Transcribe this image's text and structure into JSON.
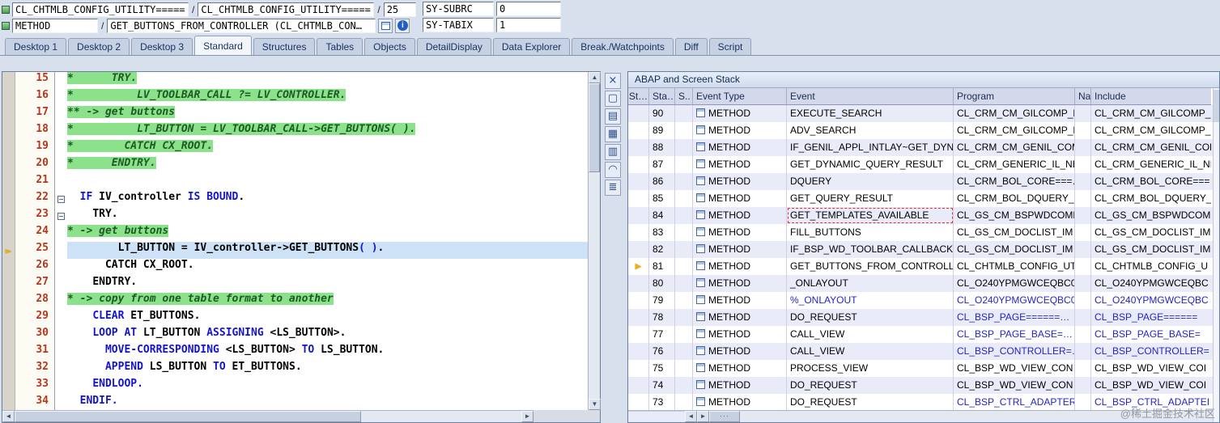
{
  "watermark": "@稀土掘金技术社区",
  "colors": {
    "comment_bg": "#8be28b",
    "comment_text": "#1d5a24",
    "current_line_bg": "#cde2f6",
    "keyword": "#1414cf",
    "line_number": "#b5381e",
    "stack_blue": "#2424c8",
    "arrow_yellow": "#f0b400",
    "selection_red": "#e03030"
  },
  "icons": {
    "up": "▲",
    "down": "▼",
    "left": "◄",
    "right": "►",
    "stack_arrow": "►",
    "info": "i"
  },
  "header": {
    "row1": {
      "program1": "CL_CHTMLB_CONFIG_UTILITY=====…",
      "sep1": "/",
      "program2": "CL_CHTMLB_CONFIG_UTILITY=====…",
      "sep2": "/",
      "line": "25",
      "sy_subrc_label": "SY-SUBRC",
      "sy_subrc_value": "0"
    },
    "row2": {
      "event_type": "METHOD",
      "sep": "/",
      "event": "GET_BUTTONS_FROM_CONTROLLER (CL_CHTMLB_CON…",
      "sy_tabix_label": "SY-TABIX",
      "sy_tabix_value": "1"
    }
  },
  "tabs": [
    {
      "label": "Desktop 1"
    },
    {
      "label": "Desktop 2"
    },
    {
      "label": "Desktop 3"
    },
    {
      "label": "Standard",
      "active": true
    },
    {
      "label": "Structures"
    },
    {
      "label": "Tables"
    },
    {
      "label": "Objects"
    },
    {
      "label": "DetailDisplay"
    },
    {
      "label": "Data Explorer"
    },
    {
      "label": "Break./Watchpoints"
    },
    {
      "label": "Diff"
    },
    {
      "label": "Script"
    }
  ],
  "side_icons": [
    {
      "name": "close-panel-icon",
      "glyph": "×"
    },
    {
      "name": "detach-view-icon",
      "glyph": "▢"
    },
    {
      "name": "layout-rows-icon",
      "glyph": "▤"
    },
    {
      "name": "layout-grid-icon",
      "glyph": "▦"
    },
    {
      "name": "layout-columns-icon",
      "glyph": "▥"
    },
    {
      "name": "services-headset-icon",
      "glyph": "◠"
    },
    {
      "name": "hierarchy-list-icon",
      "glyph": "≣"
    }
  ],
  "editor": {
    "lines": [
      {
        "no": 15,
        "green": true,
        "segs": [
          [
            "*      TRY.",
            "cm"
          ]
        ]
      },
      {
        "no": 16,
        "green": true,
        "segs": [
          [
            "*          LV_TOOLBAR_CALL ?= LV_CONTROLLER.",
            "cm"
          ]
        ]
      },
      {
        "no": 17,
        "green": true,
        "segs": [
          [
            "** -> get buttons",
            "cm"
          ]
        ]
      },
      {
        "no": 18,
        "green": true,
        "segs": [
          [
            "*          LT_BUTTON = LV_TOOLBAR_CALL->GET_BUTTONS( ).",
            "cm"
          ]
        ]
      },
      {
        "no": 19,
        "green": true,
        "segs": [
          [
            "*        CATCH CX_ROOT.",
            "cm"
          ]
        ]
      },
      {
        "no": 20,
        "green": true,
        "segs": [
          [
            "*      ENDTRY.",
            "cm"
          ]
        ]
      },
      {
        "no": 21,
        "segs": []
      },
      {
        "no": 22,
        "fold": true,
        "segs": [
          [
            "  ",
            "pl"
          ],
          [
            "IF",
            "kw"
          ],
          [
            " ",
            "pl"
          ],
          [
            "IV_controller",
            "id"
          ],
          [
            " ",
            "pl"
          ],
          [
            "IS",
            "kw"
          ],
          [
            " ",
            "pl"
          ],
          [
            "BOUND",
            "kw"
          ],
          [
            ".",
            "pl"
          ]
        ]
      },
      {
        "no": 23,
        "fold": true,
        "segs": [
          [
            "    ",
            "pl"
          ],
          [
            "TRY.",
            "id"
          ]
        ]
      },
      {
        "no": 24,
        "green": true,
        "segs": [
          [
            "* -> get buttons",
            "cm"
          ]
        ]
      },
      {
        "no": 25,
        "current": true,
        "segs": [
          [
            "        ",
            "pl"
          ],
          [
            "LT_BUTTON",
            "id"
          ],
          [
            " = ",
            "pl"
          ],
          [
            "IV_controller",
            "id"
          ],
          [
            "->",
            "pl"
          ],
          [
            "GET_BUTTONS",
            "id"
          ],
          [
            "( )",
            "kw"
          ],
          [
            ".",
            "pl"
          ]
        ]
      },
      {
        "no": 26,
        "segs": [
          [
            "      ",
            "pl"
          ],
          [
            "CATCH CX_ROOT.",
            "id"
          ]
        ]
      },
      {
        "no": 27,
        "segs": [
          [
            "    ",
            "pl"
          ],
          [
            "ENDTRY.",
            "id"
          ]
        ]
      },
      {
        "no": 28,
        "green": true,
        "segs": [
          [
            "* -> copy from one table format to another",
            "cm"
          ]
        ]
      },
      {
        "no": 29,
        "segs": [
          [
            "    ",
            "pl"
          ],
          [
            "CLEAR",
            "kw"
          ],
          [
            " ",
            "pl"
          ],
          [
            "ET_BUTTONS",
            "id"
          ],
          [
            ".",
            "pl"
          ]
        ]
      },
      {
        "no": 30,
        "segs": [
          [
            "    ",
            "pl"
          ],
          [
            "LOOP AT",
            "kw"
          ],
          [
            " ",
            "pl"
          ],
          [
            "LT_BUTTON",
            "id"
          ],
          [
            " ",
            "pl"
          ],
          [
            "ASSIGNING",
            "kw"
          ],
          [
            " ",
            "pl"
          ],
          [
            "<LS_BUTTON>",
            "id"
          ],
          [
            ".",
            "pl"
          ]
        ]
      },
      {
        "no": 31,
        "segs": [
          [
            "      ",
            "pl"
          ],
          [
            "MOVE-CORRESPONDING",
            "kw"
          ],
          [
            " ",
            "pl"
          ],
          [
            "<LS_BUTTON>",
            "id"
          ],
          [
            " ",
            "pl"
          ],
          [
            "TO",
            "kw"
          ],
          [
            " ",
            "pl"
          ],
          [
            "LS_BUTTON",
            "id"
          ],
          [
            ".",
            "pl"
          ]
        ]
      },
      {
        "no": 32,
        "segs": [
          [
            "      ",
            "pl"
          ],
          [
            "APPEND",
            "kw"
          ],
          [
            " ",
            "pl"
          ],
          [
            "LS_BUTTON",
            "id"
          ],
          [
            " ",
            "pl"
          ],
          [
            "TO",
            "kw"
          ],
          [
            " ",
            "pl"
          ],
          [
            "ET_BUTTONS",
            "id"
          ],
          [
            ".",
            "pl"
          ]
        ]
      },
      {
        "no": 33,
        "segs": [
          [
            "    ",
            "pl"
          ],
          [
            "ENDLOOP.",
            "kw"
          ]
        ]
      },
      {
        "no": 34,
        "segs": [
          [
            "  ",
            "pl"
          ],
          [
            "ENDIF.",
            "kw"
          ]
        ]
      }
    ]
  },
  "stack": {
    "title": "ABAP and Screen Stack",
    "columns": [
      "St…",
      "Sta…",
      "S..",
      "Event Type",
      "Event",
      "Program",
      "Na…",
      "Include"
    ],
    "rows": [
      {
        "level": "90",
        "event_type": "METHOD",
        "event": "EXECUTE_SEARCH",
        "program": "CL_CRM_CM_GILCOMP_D…",
        "include": "CL_CRM_CM_GILCOMP_I"
      },
      {
        "level": "89",
        "event_type": "METHOD",
        "event": "ADV_SEARCH",
        "program": "CL_CRM_CM_GILCOMP_D…",
        "include": "CL_CRM_CM_GILCOMP_I"
      },
      {
        "level": "88",
        "event_type": "METHOD",
        "event": "IF_GENIL_APPL_INTLAY~GET_DYN…",
        "program": "CL_CRM_CM_GENIL_COM…",
        "include": "CL_CRM_CM_GENIL_COM"
      },
      {
        "level": "87",
        "event_type": "METHOD",
        "event": "GET_DYNAMIC_QUERY_RESULT",
        "program": "CL_CRM_GENERIC_IL_NE…",
        "include": "CL_CRM_GENERIC_IL_NE"
      },
      {
        "level": "86",
        "event_type": "METHOD",
        "event": "DQUERY",
        "program": "CL_CRM_BOL_CORE===…",
        "include": "CL_CRM_BOL_CORE==="
      },
      {
        "level": "85",
        "event_type": "METHOD",
        "event": "GET_QUERY_RESULT",
        "program": "CL_CRM_BOL_DQUERY_…",
        "include": "CL_CRM_BOL_DQUERY_"
      },
      {
        "level": "84",
        "event_type": "METHOD",
        "event": "GET_TEMPLATES_AVAILABLE",
        "program": "CL_GS_CM_BSPWDCOMP…",
        "include": "CL_GS_CM_BSPWDCOMI",
        "event_selected": true
      },
      {
        "level": "83",
        "event_type": "METHOD",
        "event": "FILL_BUTTONS",
        "program": "CL_GS_CM_DOCLIST_IM…",
        "include": "CL_GS_CM_DOCLIST_IM"
      },
      {
        "level": "82",
        "event_type": "METHOD",
        "event": "IF_BSP_WD_TOOLBAR_CALLBACK~…",
        "program": "CL_GS_CM_DOCLIST_IM…",
        "include": "CL_GS_CM_DOCLIST_IM"
      },
      {
        "level": "81",
        "event_type": "METHOD",
        "event": "GET_BUTTONS_FROM_CONTROLLER",
        "program": "CL_CHTMLB_CONFIG_UT…",
        "include": "CL_CHTMLB_CONFIG_U",
        "current": true
      },
      {
        "level": "80",
        "event_type": "METHOD",
        "event": "_ONLAYOUT",
        "program": "CL_O240YPMGWCEQBC0…",
        "include": "CL_O240YPMGWCEQBC"
      },
      {
        "level": "79",
        "event_type": "METHOD",
        "event": "%_ONLAYOUT",
        "program": "CL_O240YPMGWCEQBC0…",
        "include": "CL_O240YPMGWCEQBC",
        "blue": true,
        "blue_event": true
      },
      {
        "level": "78",
        "event_type": "METHOD",
        "event": "DO_REQUEST",
        "program": "CL_BSP_PAGE======…",
        "include": "CL_BSP_PAGE======",
        "blue": true
      },
      {
        "level": "77",
        "event_type": "METHOD",
        "event": "CALL_VIEW",
        "program": "CL_BSP_PAGE_BASE=…",
        "include": "CL_BSP_PAGE_BASE=",
        "blue": true
      },
      {
        "level": "76",
        "event_type": "METHOD",
        "event": "CALL_VIEW",
        "program": "CL_BSP_CONTROLLER=…",
        "include": "CL_BSP_CONTROLLER=",
        "blue": true
      },
      {
        "level": "75",
        "event_type": "METHOD",
        "event": "PROCESS_VIEW",
        "program": "CL_BSP_WD_VIEW_CON…",
        "include": "CL_BSP_WD_VIEW_COI"
      },
      {
        "level": "74",
        "event_type": "METHOD",
        "event": "DO_REQUEST",
        "program": "CL_BSP_WD_VIEW_CON…",
        "include": "CL_BSP_WD_VIEW_COI"
      },
      {
        "level": "73",
        "event_type": "METHOD",
        "event": "DO_REQUEST",
        "program": "CL_BSP_CTRL_ADAPTER…",
        "include": "CL_BSP_CTRL_ADAPTEI",
        "blue": true
      }
    ]
  }
}
